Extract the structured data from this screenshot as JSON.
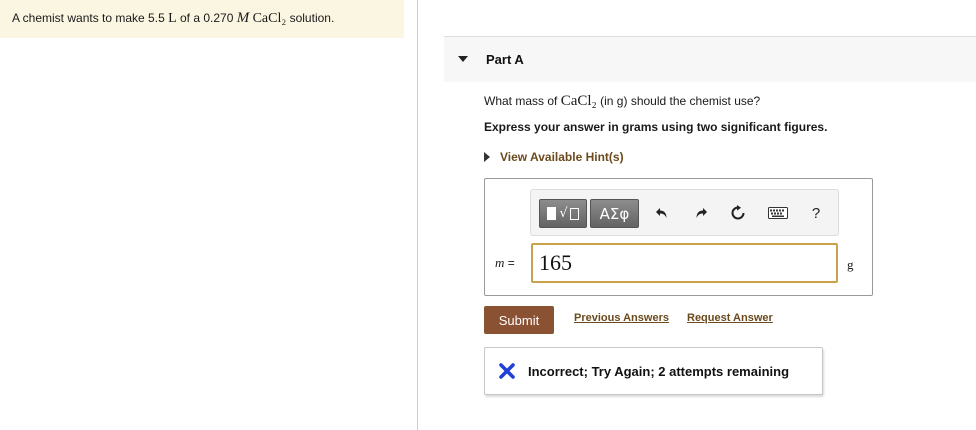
{
  "intro": {
    "prefix": "A chemist wants to make 5.5",
    "volume_unit": "L",
    "of_a": "of a 0.270",
    "molarity_unit": "M",
    "compound": "CaCl₂",
    "suffix": "solution."
  },
  "part": {
    "title": "Part A"
  },
  "question": {
    "prefix": "What mass of",
    "compound": "CaCl₂",
    "unit_hint": "(in g)",
    "suffix": "should the chemist use?",
    "instruction": "Express your answer in grams using two significant figures.",
    "hint_link": "View Available Hint(s)"
  },
  "toolbar": {
    "template_button": "template-icon",
    "greek_label": "ΑΣφ",
    "undo": "undo-icon",
    "redo": "redo-icon",
    "reset": "reset-icon",
    "keyboard": "keyboard-icon",
    "help_label": "?"
  },
  "answer": {
    "variable": "m",
    "equals": "=",
    "value": "165",
    "unit": "g"
  },
  "actions": {
    "submit": "Submit",
    "previous_answers": "Previous Answers",
    "request_answer": "Request Answer"
  },
  "feedback": {
    "icon": "x-mark-icon",
    "message": "Incorrect; Try Again; 2 attempts remaining"
  },
  "colors": {
    "intro_bg": "#fbf6e1",
    "submit_bg": "#8a5133",
    "link": "#6b4a1e",
    "input_border": "#c9a34a",
    "incorrect_x": "#1f3fd6"
  }
}
